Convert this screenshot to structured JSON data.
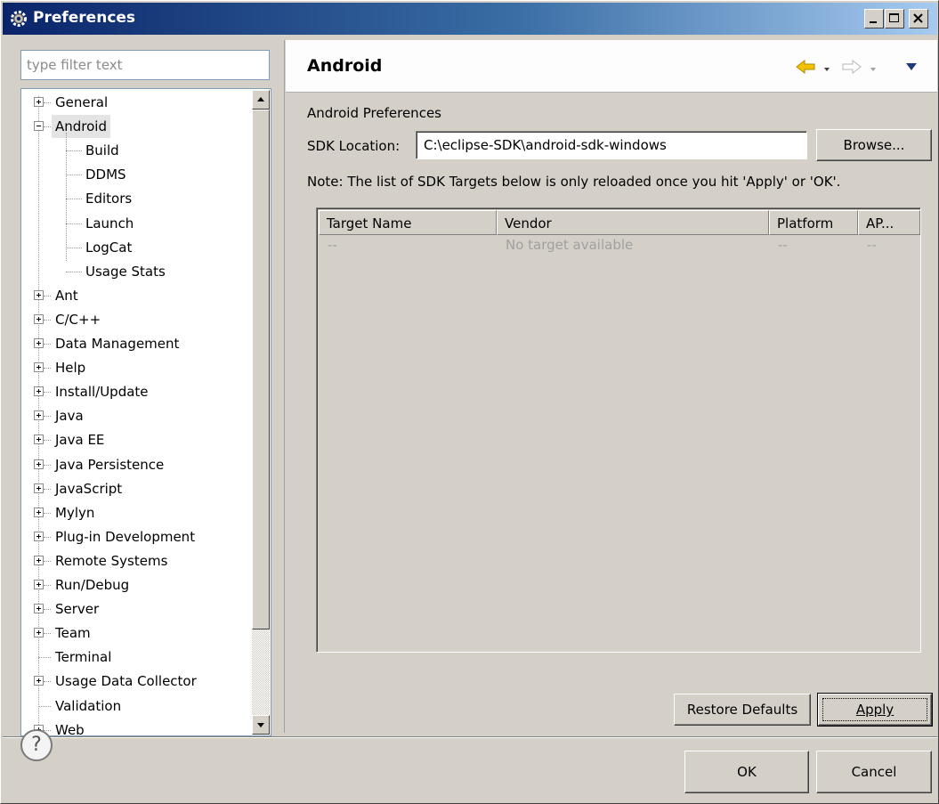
{
  "window": {
    "title": "Preferences"
  },
  "filter": {
    "placeholder": "type filter text"
  },
  "tree": {
    "items": [
      {
        "label": "General",
        "expander": "plus"
      },
      {
        "label": "Android",
        "expander": "minus",
        "selected": true
      },
      {
        "label": "Build",
        "child": true
      },
      {
        "label": "DDMS",
        "child": true
      },
      {
        "label": "Editors",
        "child": true
      },
      {
        "label": "Launch",
        "child": true
      },
      {
        "label": "LogCat",
        "child": true
      },
      {
        "label": "Usage Stats",
        "child": true
      },
      {
        "label": "Ant",
        "expander": "plus"
      },
      {
        "label": "C/C++",
        "expander": "plus"
      },
      {
        "label": "Data Management",
        "expander": "plus"
      },
      {
        "label": "Help",
        "expander": "plus"
      },
      {
        "label": "Install/Update",
        "expander": "plus"
      },
      {
        "label": "Java",
        "expander": "plus"
      },
      {
        "label": "Java EE",
        "expander": "plus"
      },
      {
        "label": "Java Persistence",
        "expander": "plus"
      },
      {
        "label": "JavaScript",
        "expander": "plus"
      },
      {
        "label": "Mylyn",
        "expander": "plus"
      },
      {
        "label": "Plug-in Development",
        "expander": "plus"
      },
      {
        "label": "Remote Systems",
        "expander": "plus"
      },
      {
        "label": "Run/Debug",
        "expander": "plus"
      },
      {
        "label": "Server",
        "expander": "plus"
      },
      {
        "label": "Team",
        "expander": "plus"
      },
      {
        "label": "Terminal",
        "expander": "none"
      },
      {
        "label": "Usage Data Collector",
        "expander": "plus"
      },
      {
        "label": "Validation",
        "expander": "none"
      },
      {
        "label": "Web",
        "expander": "plus"
      }
    ]
  },
  "page": {
    "title": "Android",
    "section_label": "Android Preferences",
    "sdk_label": "SDK Location:",
    "sdk_value": "C:\\eclipse-SDK\\android-sdk-windows",
    "browse_label": "Browse...",
    "note": "Note: The list of SDK Targets below is only reloaded once you hit 'Apply' or 'OK'."
  },
  "targets_table": {
    "columns": [
      "Target Name",
      "Vendor",
      "Platform",
      "AP..."
    ],
    "rows": [
      [
        "--",
        "No target available",
        "--",
        "--"
      ]
    ]
  },
  "buttons": {
    "restore_defaults": "Restore Defaults",
    "apply": "Apply",
    "ok": "OK",
    "cancel": "Cancel"
  },
  "colors": {
    "title_bar_start": "#0a246a",
    "title_bar_end": "#a6caf0",
    "dialog_bg": "#d4d0c8",
    "nav_back_arrow": "#f2c200"
  },
  "icons": [
    "preferences-gear-icon",
    "minimize-icon",
    "maximize-icon",
    "close-icon",
    "back-arrow-icon",
    "forward-arrow-icon",
    "view-menu-icon",
    "help-icon"
  ]
}
